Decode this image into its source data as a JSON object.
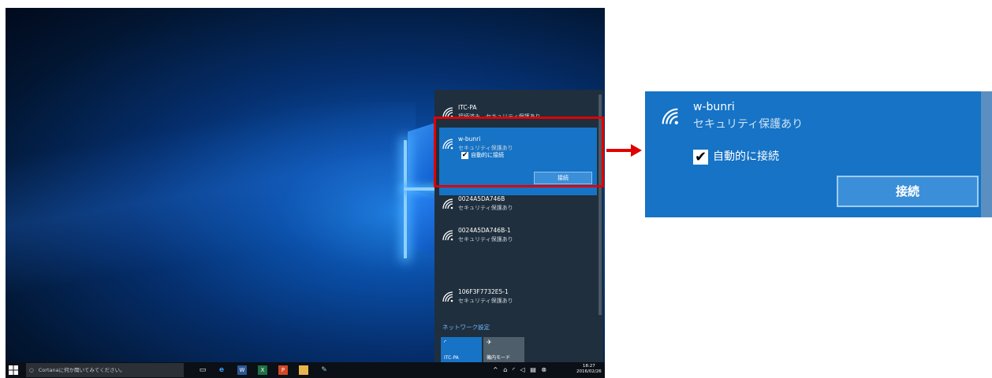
{
  "flyout": {
    "networks": [
      {
        "name": "ITC-PA",
        "status": "接続済み、セキュリティ保護あり"
      },
      {
        "name": "w-bunri",
        "status": "セキュリティ保護あり",
        "auto_connect_label": "自動的に接続",
        "auto_connect_checked": true,
        "connect_button": "接続"
      },
      {
        "name": "0024A5DA746B",
        "status": "セキュリティ保護あり"
      },
      {
        "name": "0024A5DA746B-1",
        "status": "セキュリティ保護あり"
      },
      {
        "name": "106F3F7732E5-1",
        "status": "セキュリティ保護あり"
      }
    ],
    "network_settings_link": "ネットワーク設定",
    "quick_actions": [
      {
        "label": "ITC-PA",
        "icon": "wifi-icon",
        "active": true
      },
      {
        "label": "機内モード",
        "icon": "airplane-icon",
        "active": false
      }
    ]
  },
  "taskbar": {
    "search_placeholder": "Cortanaに何か聞いてみてください。",
    "time": "18:27",
    "date": "2016/02/26",
    "pinned_icons": [
      "task-view-icon",
      "edge-icon",
      "word-icon",
      "excel-icon",
      "powerpoint-icon",
      "file-explorer-icon",
      "paint-icon"
    ],
    "tray_icons": [
      "chevron-up-icon",
      "network-icon",
      "wifi-icon",
      "volume-icon",
      "action-center-icon",
      "status-icon"
    ]
  },
  "zoom": {
    "name": "w-bunri",
    "status": "セキュリティ保護あり",
    "auto_connect_label": "自動的に接続",
    "connect_button": "接続"
  },
  "colors": {
    "accent": "#1673c5",
    "flyout_bg": "#1f2f3d",
    "highlight": "#e00000",
    "link": "#73b7ff"
  }
}
